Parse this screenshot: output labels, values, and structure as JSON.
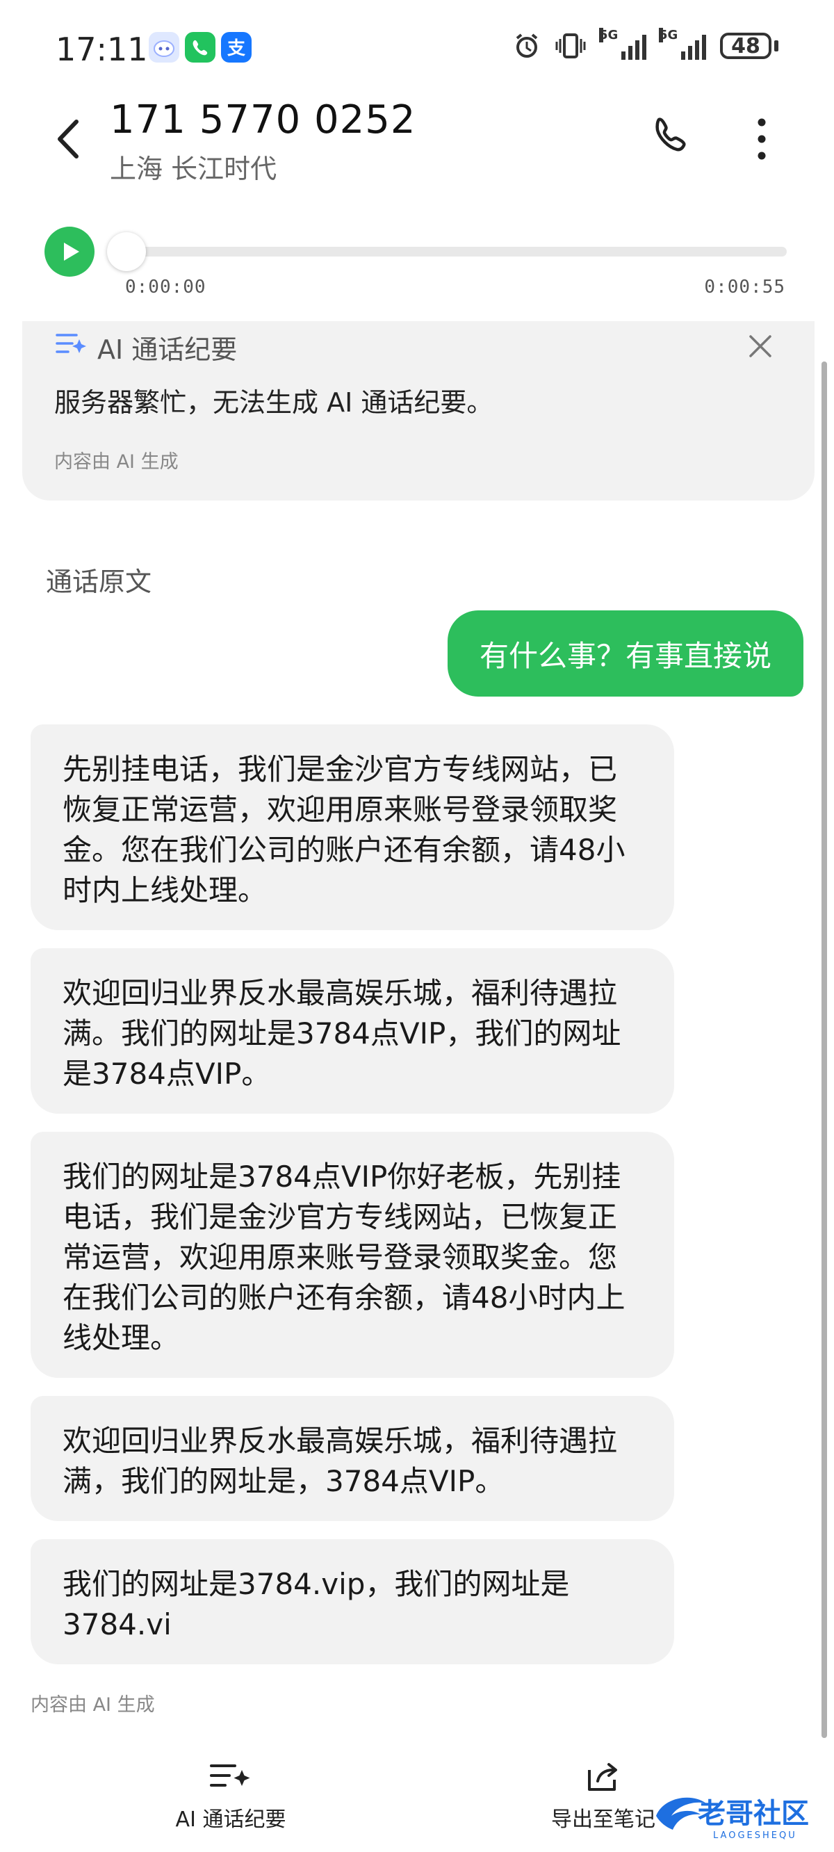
{
  "status_bar": {
    "time": "17:11",
    "network_1": "5G",
    "network_2": "5G",
    "battery": "48"
  },
  "header": {
    "title": "171 5770 0252",
    "subtitle": "上海 长江时代"
  },
  "player": {
    "current_time": "0:00:00",
    "total_time": "0:00:55",
    "progress": 0
  },
  "ai_summary": {
    "title": "AI 通话纪要",
    "message": "服务器繁忙，无法生成 AI 通话纪要。",
    "note": "内容由 AI 生成"
  },
  "transcript": {
    "section_label": "通话原文",
    "outgoing": "有什么事？有事直接说",
    "incoming": [
      "先别挂电话，我们是金沙官方专线网站，已恢复正常运营，欢迎用原来账号登录领取奖金。您在我们公司的账户还有余额，请48小时内上线处理。",
      "欢迎回归业界反水最高娱乐城，福利待遇拉满。我们的网址是3784点VIP，我们的网址是3784点VIP。",
      "我们的网址是3784点VIP你好老板，先别挂电话，我们是金沙官方专线网站，已恢复正常运营，欢迎用原来账号登录领取奖金。您在我们公司的账户还有余额，请48小时内上线处理。",
      "欢迎回归业界反水最高娱乐城，福利待遇拉满，我们的网址是，3784点VIP。",
      "我们的网址是3784.vip，我们的网址是3784.vi"
    ],
    "footer_note": "内容由 AI 生成"
  },
  "bottom_bar": {
    "ai_summary_label": "AI 通话纪要",
    "export_label": "导出至笔记"
  },
  "watermark": {
    "text": "老哥社区",
    "subtext": "LAOGESHEQU"
  },
  "colors": {
    "accent": "#2dbe5c",
    "bubble_gray": "#f2f2f2"
  }
}
